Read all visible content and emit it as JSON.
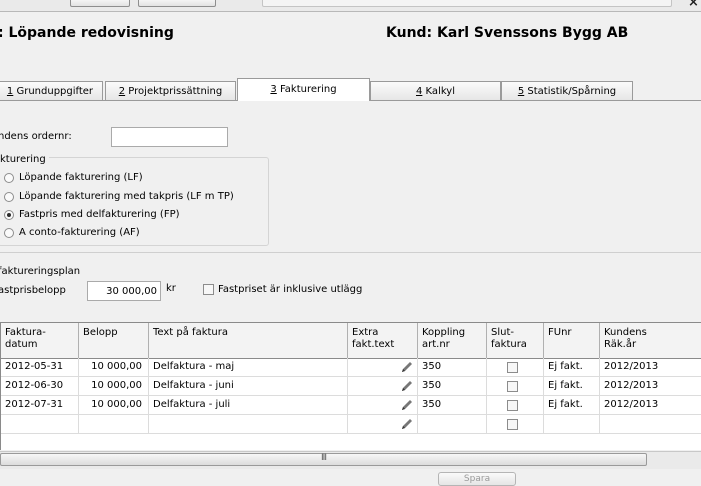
{
  "header": {
    "title": ": Löpande redovisning",
    "customer": "Kund: Karl Svenssons Bygg AB"
  },
  "tabs": [
    {
      "num": "1",
      "label": " Grunduppgifter"
    },
    {
      "num": "2",
      "label": " Projektprissättning"
    },
    {
      "num": "3",
      "label": " Fakturering"
    },
    {
      "num": "4",
      "label": " Kalkyl"
    },
    {
      "num": "5",
      "label": " Statistik/Spårning"
    }
  ],
  "order": {
    "label": "ndens ordernr:",
    "value": ""
  },
  "invoicing": {
    "group_label": "kturering",
    "options": [
      {
        "label": "Löpande fakturering (LF)",
        "selected": false
      },
      {
        "label": "Löpande fakturering med takpris (LF m TP)",
        "selected": false
      },
      {
        "label": "Fastpris med delfakturering (FP)",
        "selected": true
      },
      {
        "label": "A conto-fakturering (AF)",
        "selected": false
      }
    ]
  },
  "plan": {
    "title": "faktureringsplan",
    "fixed_price_label": "astprisbelopp",
    "fixed_price_value": "30 000,00",
    "currency": "kr",
    "inclusive_label": "Fastpriset är inklusive utlägg",
    "inclusive_checked": false
  },
  "grid": {
    "columns": [
      "Faktura-\ndatum",
      "Belopp",
      "Text på faktura",
      "Extra\nfakt.text",
      "Koppling\nart.nr",
      "Slut-\nfaktura",
      "FUnr",
      "Kundens\nRäk.år"
    ],
    "rows": [
      {
        "date": "2012-05-31",
        "amount": "10 000,00",
        "text": "Delfaktura - maj",
        "article": "350",
        "final": false,
        "funr": "Ej fakt.",
        "year": "2012/2013"
      },
      {
        "date": "2012-06-30",
        "amount": "10 000,00",
        "text": "Delfaktura - juni",
        "article": "350",
        "final": false,
        "funr": "Ej fakt.",
        "year": "2012/2013"
      },
      {
        "date": "2012-07-31",
        "amount": "10 000,00",
        "text": "Delfaktura - juli",
        "article": "350",
        "final": false,
        "funr": "Ej fakt.",
        "year": "2012/2013"
      },
      {
        "date": "",
        "amount": "",
        "text": "",
        "article": "",
        "final": false,
        "funr": "",
        "year": ""
      }
    ]
  },
  "scrollbar": {
    "grip": "III"
  },
  "footer": {
    "button_label": "Spara"
  },
  "colors": {
    "background": "#f0f0f0",
    "grid_header": "#f3f3f3",
    "tab_border": "#9a9a9a"
  },
  "icons": {
    "pencil": "pencil-icon",
    "close": "close-icon"
  }
}
